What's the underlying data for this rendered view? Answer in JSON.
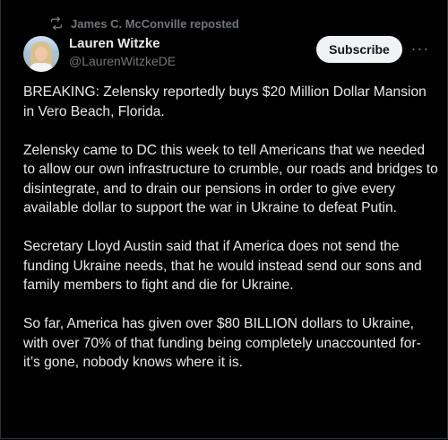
{
  "repost": {
    "icon": "repost-icon",
    "text": "James C. McConville reposted"
  },
  "author": {
    "avatar": "avatar",
    "name": "Lauren Witzke",
    "handle": "@LaurenWitzkeDE"
  },
  "actions": {
    "subscribe_label": "Subscribe",
    "more_label": "···"
  },
  "tweet": {
    "paragraphs": [
      "BREAKING: Zelensky reportedly buys $20 Million Dollar Mansion in Vero Beach, Florida.",
      " Zelensky came to DC this week to tell Americans that we needed to allow our own infrastructure to crumble, our roads and bridges to disintegrate, and to drain our pensions in order to give every available dollar to support the war in Ukraine to defeat Putin.",
      "Secretary Lloyd Austin said that if America does not send the funding Ukraine needs, that he would instead send our sons and family members to fight and die for Ukraine.",
      "So far, America has given over $80 BILLION dollars to Ukraine, with over 70% of that funding being completely unaccounted for- it’s gone, nobody knows where it is."
    ]
  },
  "colors": {
    "background": "#000000",
    "text_primary": "#e7e9ea",
    "text_secondary": "#71767b",
    "button_bg": "#eff3f4",
    "button_text": "#0f1419"
  }
}
